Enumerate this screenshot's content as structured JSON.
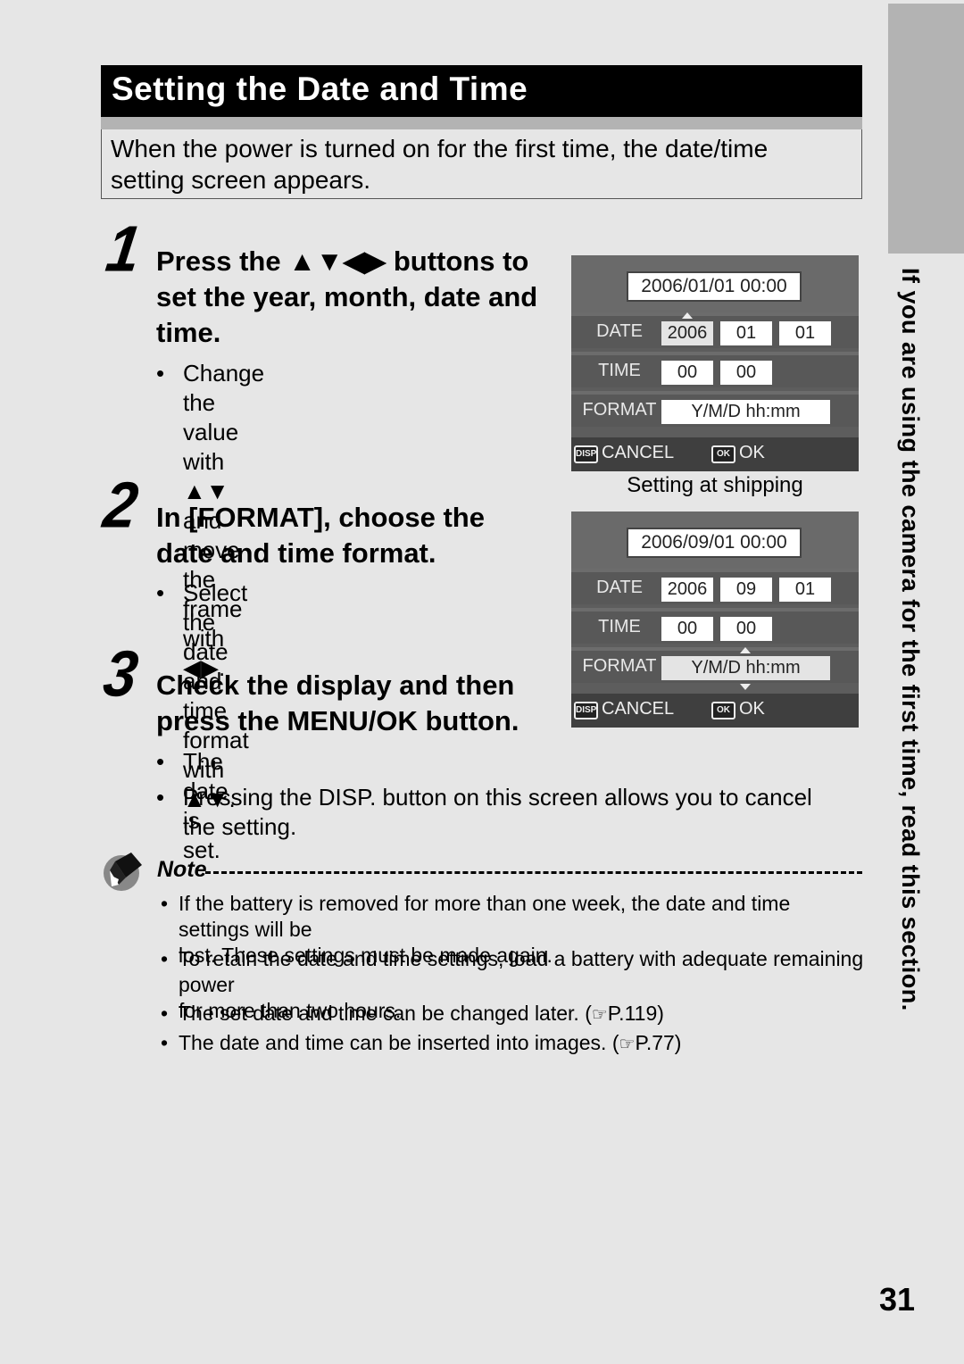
{
  "side_tab": {
    "text": "If you are using the camera for the first time, read this section."
  },
  "title": "Setting the Date and Time",
  "intro": "When the power is turned on for the first time, the date/time setting screen appears.",
  "steps": [
    {
      "number": "1",
      "heading_lines": [
        "Press the ▲▼◀▶ buttons to",
        "set the year, month, date and",
        "time."
      ],
      "bullets": [
        [
          "Change the value with ▲▼ and",
          "move the frame with ◀▶."
        ]
      ]
    },
    {
      "number": "2",
      "heading_lines": [
        "In [FORMAT], choose the",
        "date and time format."
      ],
      "bullets": [
        [
          "Select the date and time format",
          "with ▲▼."
        ]
      ]
    },
    {
      "number": "3",
      "heading_lines": [
        "Check the display and then",
        "press the MENU/OK button."
      ],
      "bullets": [
        [
          "The date is set."
        ],
        [
          "Pressing the DISP. button on this screen allows you to cancel",
          "the setting."
        ]
      ]
    }
  ],
  "screens": [
    {
      "display": "2006/01/01 00:00",
      "date_label": "DATE",
      "date_fields": [
        "2006",
        "01",
        "01"
      ],
      "time_label": "TIME",
      "time_fields": [
        "00",
        "00"
      ],
      "format_label": "FORMAT",
      "format_value": "Y/M/D hh:mm",
      "cancel_icon": "DISP",
      "cancel_label": "CANCEL",
      "ok_icon": "OK",
      "ok_label": "OK",
      "selected_field": "year",
      "caption": "Setting at shipping"
    },
    {
      "display": "2006/09/01 00:00",
      "date_label": "DATE",
      "date_fields": [
        "2006",
        "09",
        "01"
      ],
      "time_label": "TIME",
      "time_fields": [
        "00",
        "00"
      ],
      "format_label": "FORMAT",
      "format_value": "Y/M/D hh:mm",
      "cancel_icon": "DISP",
      "cancel_label": "CANCEL",
      "ok_icon": "OK",
      "ok_label": "OK",
      "selected_field": "format"
    }
  ],
  "note": {
    "label": "Note",
    "items": [
      [
        "If the battery is removed for more than one week, the date and time settings will be",
        "lost. These settings must be made again."
      ],
      [
        "To retain the date and time settings, load a battery with adequate remaining power",
        "for more than two hours."
      ],
      [
        "The set date and time can be changed later. (",
        "P.119)"
      ],
      [
        "The date and time can be inserted into images. (",
        "P.77)"
      ]
    ],
    "bullet": "•",
    "ref_icon": "☞"
  },
  "page_number": "31"
}
